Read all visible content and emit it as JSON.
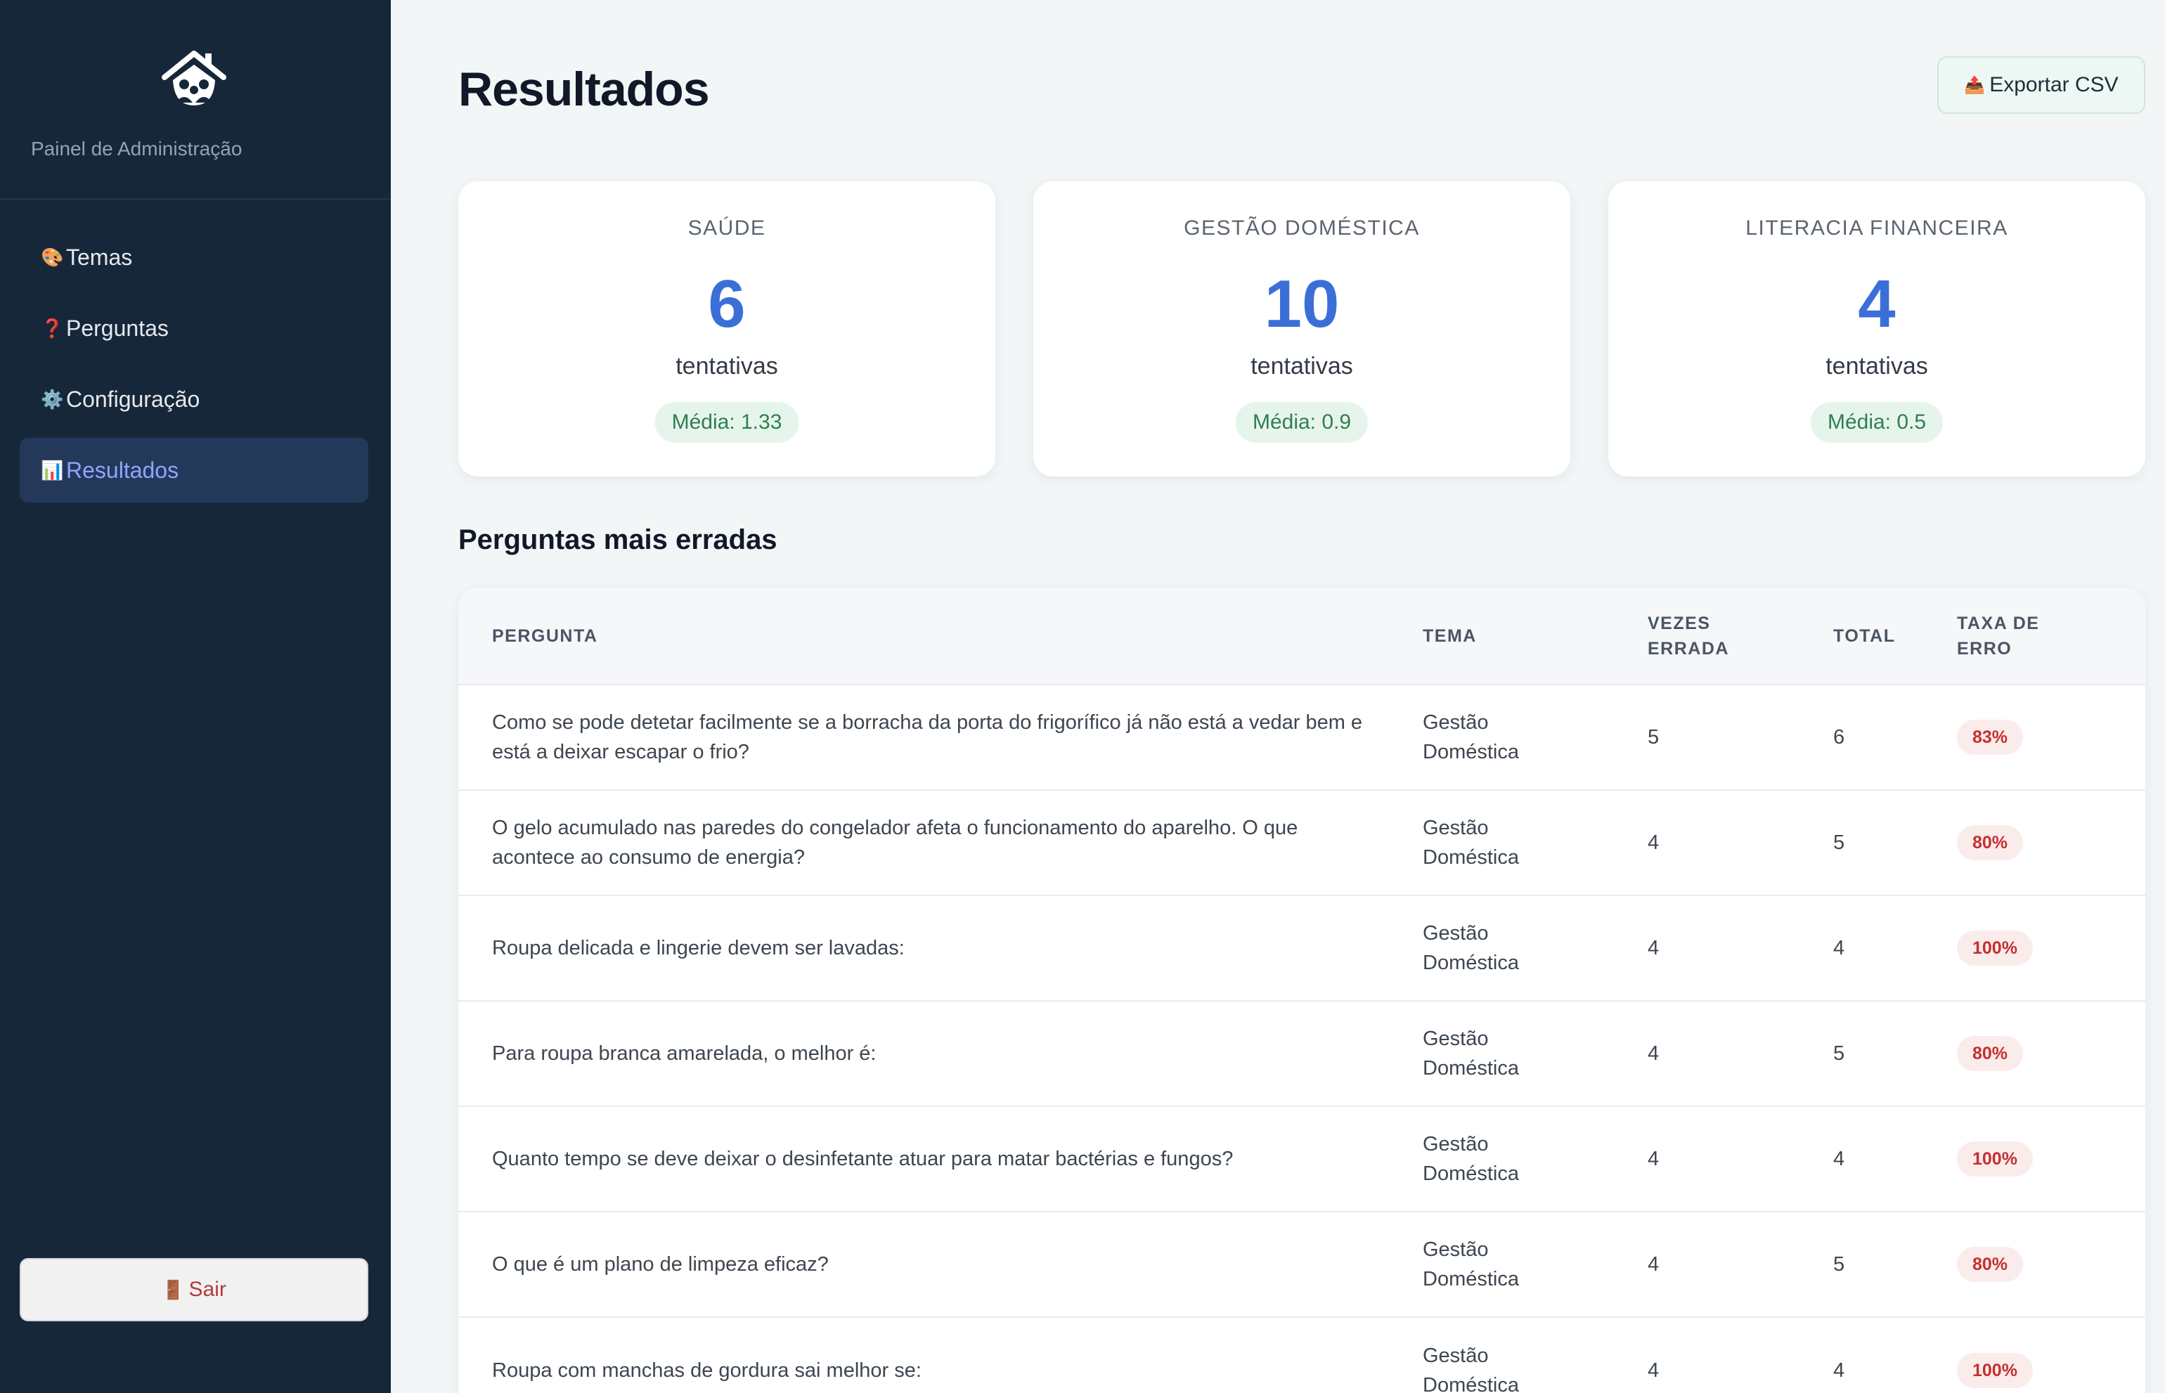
{
  "sidebar": {
    "subtitle": "Painel de Administração",
    "items": [
      {
        "icon": "🎨",
        "icon_name": "palette-icon",
        "label": "Temas",
        "active": false
      },
      {
        "icon": "❓",
        "icon_name": "question-icon",
        "label": "Perguntas",
        "active": false
      },
      {
        "icon": "⚙️",
        "icon_name": "gear-icon",
        "label": "Configuração",
        "active": false
      },
      {
        "icon": "📊",
        "icon_name": "bar-chart-icon",
        "label": "Resultados",
        "active": true
      }
    ],
    "logout": {
      "icon": "🚪",
      "label": "Sair"
    }
  },
  "header": {
    "title": "Resultados",
    "export_icon": "📤",
    "export_label": "Exportar CSV"
  },
  "cards": [
    {
      "label": "SAÚDE",
      "value": "6",
      "unit": "tentativas",
      "average": "Média: 1.33"
    },
    {
      "label": "GESTÃO DOMÉSTICA",
      "value": "10",
      "unit": "tentativas",
      "average": "Média: 0.9"
    },
    {
      "label": "LITERACIA FINANCEIRA",
      "value": "4",
      "unit": "tentativas",
      "average": "Média: 0.5"
    }
  ],
  "section": {
    "title": "Perguntas mais erradas"
  },
  "table": {
    "headers": {
      "question": "PERGUNTA",
      "theme": "TEMA",
      "wrong": "VEZES ERRADA",
      "total": "TOTAL",
      "rate": "TAXA DE ERRO"
    },
    "rows": [
      {
        "question": "Como se pode detetar facilmente se a borracha da porta do frigorífico já não está a vedar bem e está a deixar escapar o frio?",
        "theme": "Gestão Doméstica",
        "wrong": "5",
        "total": "6",
        "rate": "83%"
      },
      {
        "question": "O gelo acumulado nas paredes do congelador afeta o funcionamento do aparelho. O que acontece ao consumo de energia?",
        "theme": "Gestão Doméstica",
        "wrong": "4",
        "total": "5",
        "rate": "80%"
      },
      {
        "question": "Roupa delicada e lingerie devem ser lavadas:",
        "theme": "Gestão Doméstica",
        "wrong": "4",
        "total": "4",
        "rate": "100%"
      },
      {
        "question": "Para roupa branca amarelada, o melhor é:",
        "theme": "Gestão Doméstica",
        "wrong": "4",
        "total": "5",
        "rate": "80%"
      },
      {
        "question": "Quanto tempo se deve deixar o desinfetante atuar para matar bactérias e fungos?",
        "theme": "Gestão Doméstica",
        "wrong": "4",
        "total": "4",
        "rate": "100%"
      },
      {
        "question": "O que é um plano de limpeza eficaz?",
        "theme": "Gestão Doméstica",
        "wrong": "4",
        "total": "5",
        "rate": "80%"
      },
      {
        "question": "Roupa com manchas de gordura sai melhor se:",
        "theme": "Gestão Doméstica",
        "wrong": "4",
        "total": "4",
        "rate": "100%"
      }
    ]
  },
  "colors": {
    "sidebar_bg": "#16273a",
    "accent_blue": "#3b6fd8",
    "active_nav_text": "#8ea6ff",
    "success_green": "#2f7f4f",
    "error_red": "#c53030"
  }
}
